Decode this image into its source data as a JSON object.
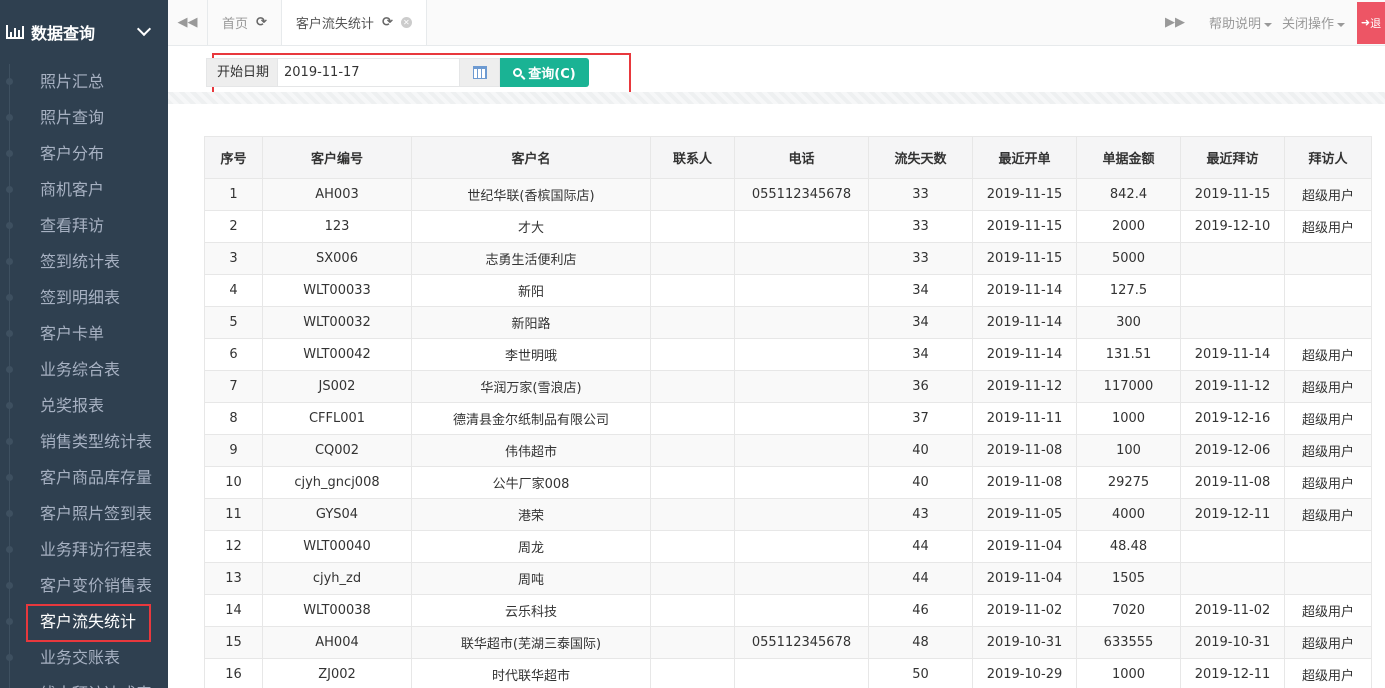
{
  "sidebar": {
    "title": "数据查询",
    "items": [
      {
        "label": "照片汇总"
      },
      {
        "label": "照片查询"
      },
      {
        "label": "客户分布"
      },
      {
        "label": "商机客户"
      },
      {
        "label": "查看拜访"
      },
      {
        "label": "签到统计表"
      },
      {
        "label": "签到明细表"
      },
      {
        "label": "客户卡单"
      },
      {
        "label": "业务综合表"
      },
      {
        "label": "兑奖报表"
      },
      {
        "label": "销售类型统计表"
      },
      {
        "label": "客户商品库存量"
      },
      {
        "label": "客户照片签到表"
      },
      {
        "label": "业务拜访行程表"
      },
      {
        "label": "客户变价销售表"
      },
      {
        "label": "客户流失统计"
      },
      {
        "label": "业务交账表"
      },
      {
        "label": "线未拜访达成表"
      }
    ],
    "active_index": 15
  },
  "tabs": {
    "home": "首页",
    "current": "客户流失统计",
    "help": "帮助说明",
    "close_ops": "关闭操作",
    "exit": "退"
  },
  "search": {
    "label": "开始日期",
    "value": "2019-11-17",
    "button": "查询(C)"
  },
  "table": {
    "columns": [
      "序号",
      "客户编号",
      "客户名",
      "联系人",
      "电话",
      "流失天数",
      "最近开单",
      "单据金额",
      "最近拜访",
      "拜访人"
    ],
    "rows": [
      [
        "1",
        "AH003",
        "世纪华联(香槟国际店)",
        "",
        "055112345678",
        "33",
        "2019-11-15",
        "842.4",
        "2019-11-15",
        "超级用户"
      ],
      [
        "2",
        "123",
        "才大",
        "",
        "",
        "33",
        "2019-11-15",
        "2000",
        "2019-12-10",
        "超级用户"
      ],
      [
        "3",
        "SX006",
        "志勇生活便利店",
        "",
        "",
        "33",
        "2019-11-15",
        "5000",
        "",
        ""
      ],
      [
        "4",
        "WLT00033",
        "新阳",
        "",
        "",
        "34",
        "2019-11-14",
        "127.5",
        "",
        ""
      ],
      [
        "5",
        "WLT00032",
        "新阳路",
        "",
        "",
        "34",
        "2019-11-14",
        "300",
        "",
        ""
      ],
      [
        "6",
        "WLT00042",
        "李世明哦",
        "",
        "",
        "34",
        "2019-11-14",
        "131.51",
        "2019-11-14",
        "超级用户"
      ],
      [
        "7",
        "JS002",
        "华润万家(雪浪店)",
        "",
        "",
        "36",
        "2019-11-12",
        "117000",
        "2019-11-12",
        "超级用户"
      ],
      [
        "8",
        "CFFL001",
        "德清县金尔纸制品有限公司",
        "",
        "",
        "37",
        "2019-11-11",
        "1000",
        "2019-12-16",
        "超级用户"
      ],
      [
        "9",
        "CQ002",
        "伟伟超市",
        "",
        "",
        "40",
        "2019-11-08",
        "100",
        "2019-12-06",
        "超级用户"
      ],
      [
        "10",
        "cjyh_gncj008",
        "公牛厂家008",
        "",
        "",
        "40",
        "2019-11-08",
        "29275",
        "2019-11-08",
        "超级用户"
      ],
      [
        "11",
        "GYS04",
        "港荣",
        "",
        "",
        "43",
        "2019-11-05",
        "4000",
        "2019-12-11",
        "超级用户"
      ],
      [
        "12",
        "WLT00040",
        "周龙",
        "",
        "",
        "44",
        "2019-11-04",
        "48.48",
        "",
        ""
      ],
      [
        "13",
        "cjyh_zd",
        "周吨",
        "",
        "",
        "44",
        "2019-11-04",
        "1505",
        "",
        ""
      ],
      [
        "14",
        "WLT00038",
        "云乐科技",
        "",
        "",
        "46",
        "2019-11-02",
        "7020",
        "2019-11-02",
        "超级用户"
      ],
      [
        "15",
        "AH004",
        "联华超市(芜湖三泰国际)",
        "",
        "055112345678",
        "48",
        "2019-10-31",
        "633555",
        "2019-10-31",
        "超级用户"
      ],
      [
        "16",
        "ZJ002",
        "时代联华超市",
        "",
        "",
        "50",
        "2019-10-29",
        "1000",
        "2019-12-11",
        "超级用户"
      ]
    ]
  },
  "icons": {
    "sidebar": "bar-chart-icon",
    "tab_prev": "double-left-icon",
    "tab_next": "double-right-icon",
    "refresh": "refresh-icon",
    "close": "close-circle-icon",
    "calendar": "calendar-icon",
    "search": "search-icon",
    "exit": "sign-out-icon"
  },
  "colors": {
    "sidebar_bg": "#2f4050",
    "primary": "#1ab394",
    "highlight": "#e8383d",
    "exit": "#ed5565"
  }
}
